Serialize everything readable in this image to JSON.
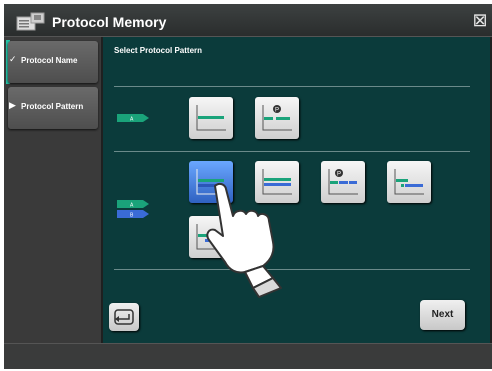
{
  "window": {
    "title": "Protocol Memory",
    "close_icon": "close-icon"
  },
  "sidebar": {
    "items": [
      {
        "label": "Protocol Name",
        "mark": "✓",
        "state": "done"
      },
      {
        "label": "Protocol Pattern",
        "mark": "▶",
        "state": "current"
      }
    ]
  },
  "main": {
    "title": "Select Protocol Pattern",
    "rows": [
      {
        "indicator": {
          "labels": [
            "A"
          ]
        },
        "tiles": [
          "pattern-1",
          "pattern-2"
        ]
      },
      {
        "indicator": {
          "labels": [
            "A",
            "B"
          ]
        },
        "tiles": [
          "pattern-3",
          "pattern-4",
          "pattern-5",
          "pattern-6",
          "pattern-7"
        ],
        "selected": "pattern-3"
      }
    ]
  },
  "footer_buttons": {
    "back_icon": "back-icon",
    "next_label": "Next"
  },
  "colors": {
    "accent": "#22c5a8",
    "teal_bg": "#0b3b3b",
    "green_line": "#1aa37a",
    "blue_line": "#3a6bd6",
    "selected_tile": "#3b6fd0"
  }
}
